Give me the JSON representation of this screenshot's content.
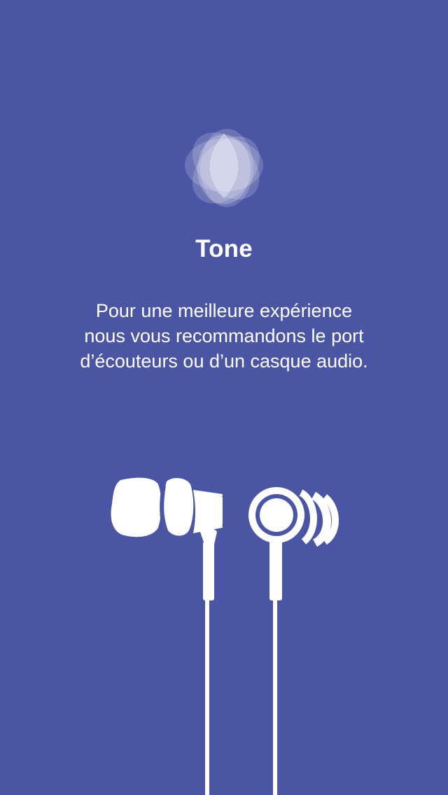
{
  "colors": {
    "background": "#4A55A4",
    "foreground": "#FFFFFF"
  },
  "logo": {
    "icon": "tone-flower-logo-icon"
  },
  "title": "Tone",
  "message": {
    "lines": [
      "Pour une meilleure expérience",
      "nous vous recommandons le port",
      "d’écouteurs ou d’un casque audio."
    ]
  },
  "illustration": {
    "icon": "earphones-icon"
  }
}
